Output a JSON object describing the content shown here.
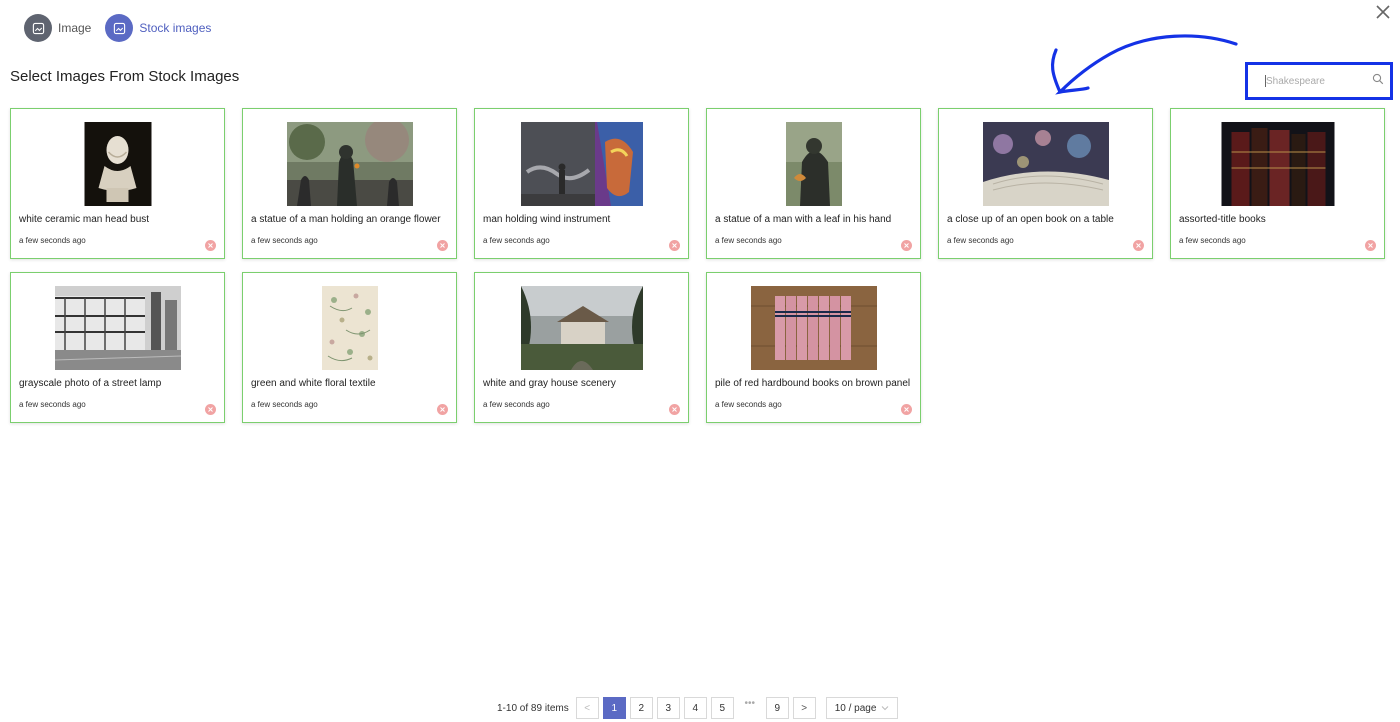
{
  "tabs": [
    {
      "label": "Image",
      "icon": "image-icon",
      "active": false
    },
    {
      "label": "Stock images",
      "icon": "image-icon",
      "active": true
    }
  ],
  "page_title": "Select Images From Stock Images",
  "search": {
    "placeholder": "Shakespeare",
    "value": ""
  },
  "colors": {
    "accent": "#5b6ac4",
    "card_border": "#7bcf6e",
    "annotation": "#1432e6",
    "remove": "#f1a3a3"
  },
  "images": [
    {
      "title": "white ceramic man head bust",
      "time": "a few seconds ago"
    },
    {
      "title": "a statue of a man holding an orange flower",
      "time": "a few seconds ago"
    },
    {
      "title": "man holding wind instrument",
      "time": "a few seconds ago"
    },
    {
      "title": "a statue of a man with a leaf in his hand",
      "time": "a few seconds ago"
    },
    {
      "title": "a close up of an open book on a table",
      "time": "a few seconds ago"
    },
    {
      "title": "assorted-title books",
      "time": "a few seconds ago"
    },
    {
      "title": "grayscale photo of a street lamp",
      "time": "a few seconds ago"
    },
    {
      "title": "green and white floral textile",
      "time": "a few seconds ago"
    },
    {
      "title": "white and gray house scenery",
      "time": "a few seconds ago"
    },
    {
      "title": "pile of red hardbound books on brown panel",
      "time": "a few seconds ago"
    }
  ],
  "pagination": {
    "total_text": "1-10 of 89 items",
    "prev_label": "<",
    "next_label": ">",
    "pages": [
      "1",
      "2",
      "3",
      "4",
      "5"
    ],
    "ellipsis": "•••",
    "last_page": "9",
    "current": "1",
    "page_size": "10 / page"
  }
}
